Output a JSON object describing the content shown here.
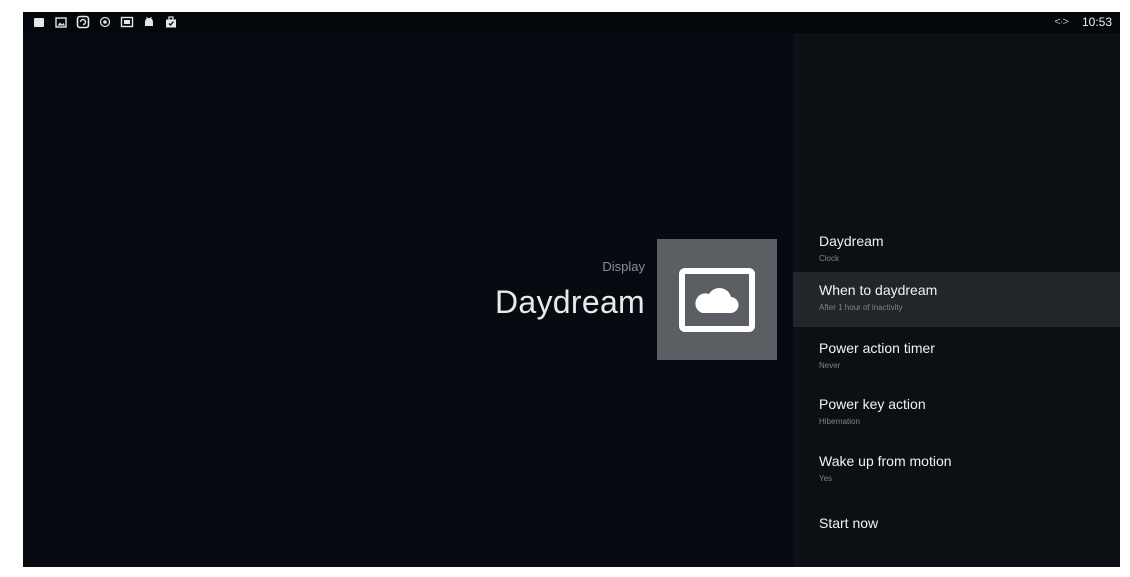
{
  "status_bar": {
    "icons": [
      "square-icon",
      "image-icon",
      "refresh-icon",
      "record-icon",
      "mail-icon",
      "android-icon",
      "briefcase-icon"
    ],
    "network_label": "<·>",
    "time": "10:53"
  },
  "header": {
    "breadcrumb": "Display",
    "title": "Daydream"
  },
  "hero_icon": "cloud-frame-icon",
  "menu": {
    "items": [
      {
        "title": "Daydream",
        "subtitle": "Clock"
      },
      {
        "title": "When to daydream",
        "subtitle": "After 1 hour of inactivity"
      },
      {
        "title": "Power action timer",
        "subtitle": "Never"
      },
      {
        "title": "Power key action",
        "subtitle": "Hibernation"
      },
      {
        "title": "Wake up from motion",
        "subtitle": "Yes"
      },
      {
        "title": "Start now",
        "subtitle": ""
      }
    ]
  },
  "colors": {
    "background": "#070b11",
    "panel": "#0c1015",
    "focus_highlight": "#21262b",
    "tile": "#5b5f63"
  }
}
